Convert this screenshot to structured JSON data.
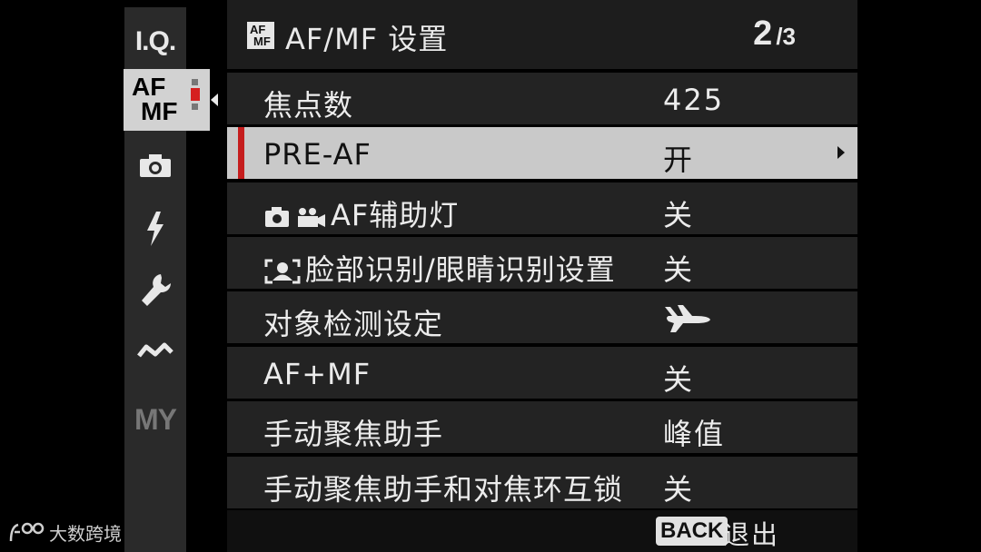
{
  "sidebar": {
    "items": [
      {
        "name": "image-quality",
        "label": "I.Q."
      },
      {
        "name": "af-mf",
        "label_line1": "AF",
        "label_line2": "MF",
        "active": true
      },
      {
        "name": "shooting",
        "icon": "camera-icon"
      },
      {
        "name": "flash",
        "icon": "flash-icon"
      },
      {
        "name": "setup",
        "icon": "wrench-icon"
      },
      {
        "name": "connection",
        "icon": "connection-icon"
      },
      {
        "name": "my-menu",
        "label": "MY"
      }
    ]
  },
  "header": {
    "icon": {
      "line1": "AF",
      "line2": "MF"
    },
    "title": "AF/MF 设置",
    "page_current": "2",
    "page_total": "/3"
  },
  "menu": {
    "rows": [
      {
        "label": "焦点数",
        "value": "425"
      },
      {
        "label": "PRE-AF",
        "value": "开",
        "selected": true
      },
      {
        "label": "AF辅助灯",
        "value": "关",
        "label_icon": "camera-movie-icon"
      },
      {
        "label": "脸部识别/眼睛识别设置",
        "value": "关",
        "label_icon": "face-detect-icon"
      },
      {
        "label": "对象检测设定",
        "value": "",
        "value_icon": "airplane-icon"
      },
      {
        "label": "AF+MF",
        "value": "关"
      },
      {
        "label": "手动聚焦助手",
        "value": "峰值"
      },
      {
        "label": "手动聚焦助手和对焦环互锁",
        "value": "关"
      }
    ]
  },
  "footer": {
    "back_key": "BACK",
    "back_label": "退出"
  },
  "watermark": {
    "text": "大数跨境"
  },
  "colors": {
    "selected_row": "#c9c9c9",
    "marker_red": "#c51d1d",
    "row_bg": "#232323",
    "header_bg": "#1d1d1d"
  }
}
